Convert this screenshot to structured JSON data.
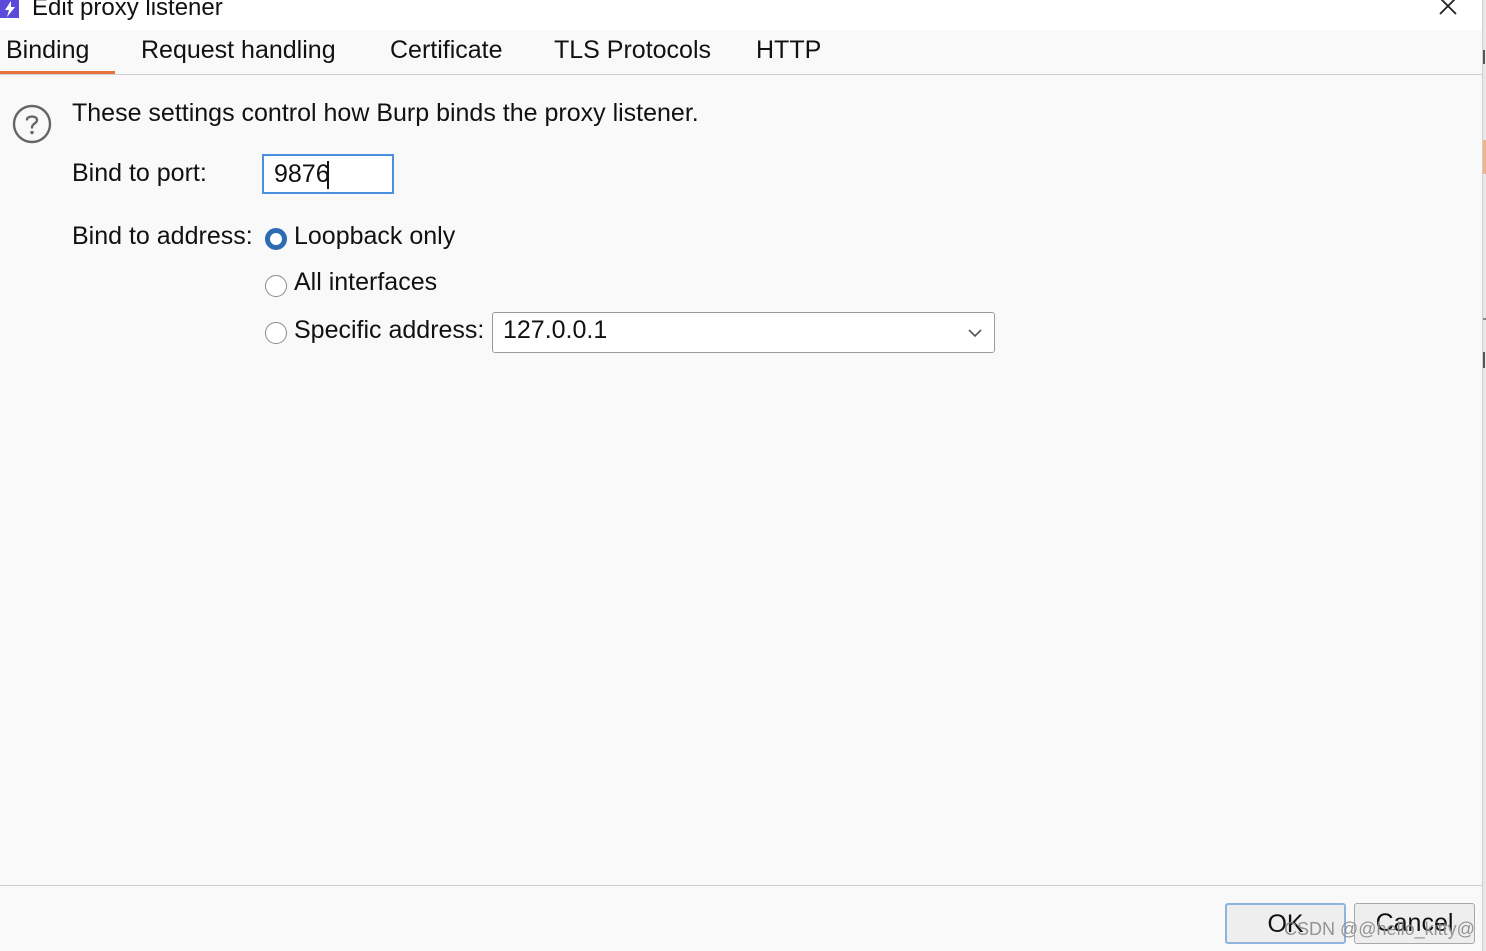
{
  "window": {
    "title": "Edit proxy listener"
  },
  "tabs": [
    {
      "label": "Binding",
      "active": true
    },
    {
      "label": "Request handling"
    },
    {
      "label": "Certificate"
    },
    {
      "label": "TLS Protocols"
    },
    {
      "label": "HTTP"
    }
  ],
  "binding": {
    "description": "These settings control how Burp binds the proxy listener.",
    "port_label": "Bind to port:",
    "port_value": "9876",
    "address_label": "Bind to address:",
    "options": [
      {
        "label": "Loopback only",
        "selected": true
      },
      {
        "label": "All interfaces",
        "selected": false
      },
      {
        "label": "Specific address:",
        "selected": false
      }
    ],
    "specific_address_value": "127.0.0.1"
  },
  "footer": {
    "ok_label": "OK",
    "cancel_label": "Cancel"
  },
  "watermark": "CSDN @@hello_kitty@",
  "colors": {
    "accent_tab": "#e8743b",
    "radio_selected": "#2d6bb3",
    "input_focus": "#4a90e2"
  },
  "icons": [
    "app-icon",
    "close-icon",
    "help-icon",
    "chevron-down-icon"
  ]
}
